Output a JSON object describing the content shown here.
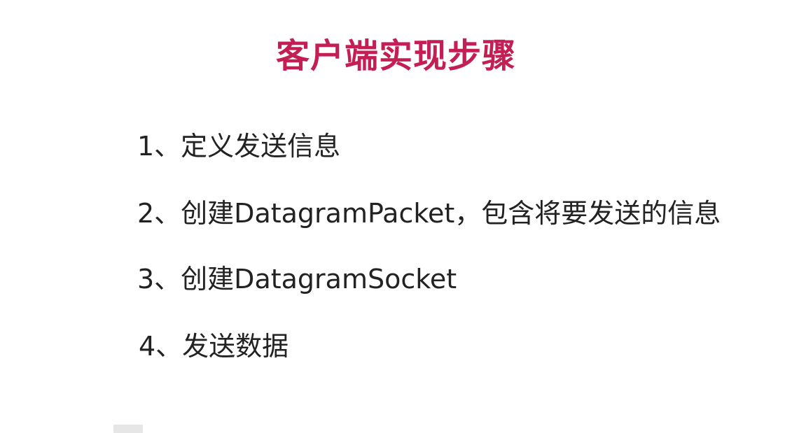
{
  "slide": {
    "title": "客户端实现步骤",
    "title_color": "#c41f55",
    "steps": [
      "1、定义发送信息",
      "2、创建DatagramPacket，包含将要发送的信息",
      "3、创建DatagramSocket",
      "4、发送数据"
    ]
  }
}
